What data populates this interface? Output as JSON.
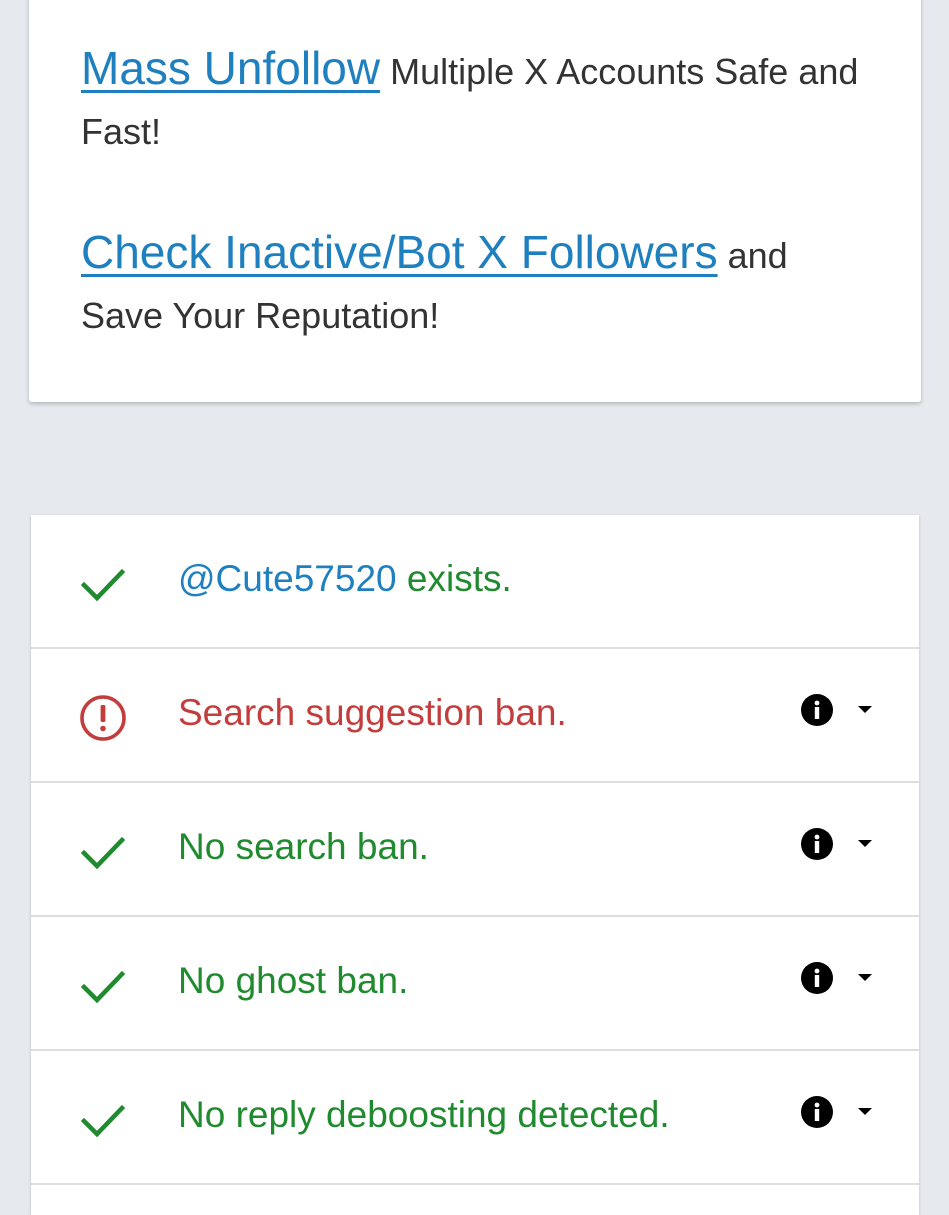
{
  "promo": {
    "line1_link": "Mass Unfollow",
    "line1_rest": "Multiple X Accounts Safe and Fast!",
    "line2_link": "Check Inactive/Bot X Followers",
    "line2_rest": "and Save Your Reputation!"
  },
  "results": {
    "account": {
      "handle": "@Cute57520",
      "status": "exists.",
      "icon": "check-icon"
    },
    "items": [
      {
        "label": "Search suggestion ban.",
        "state": "fail",
        "icon": "alert-circle-icon"
      },
      {
        "label": "No search ban.",
        "state": "pass",
        "icon": "check-icon"
      },
      {
        "label": "No ghost ban.",
        "state": "pass",
        "icon": "check-icon"
      },
      {
        "label": "No reply deboosting detected.",
        "state": "pass",
        "icon": "check-icon"
      }
    ]
  },
  "colors": {
    "background": "#e6eaee",
    "link_blue": "#1f80c0",
    "pass_green": "#1f8a2e",
    "fail_red": "#c43d3d"
  }
}
